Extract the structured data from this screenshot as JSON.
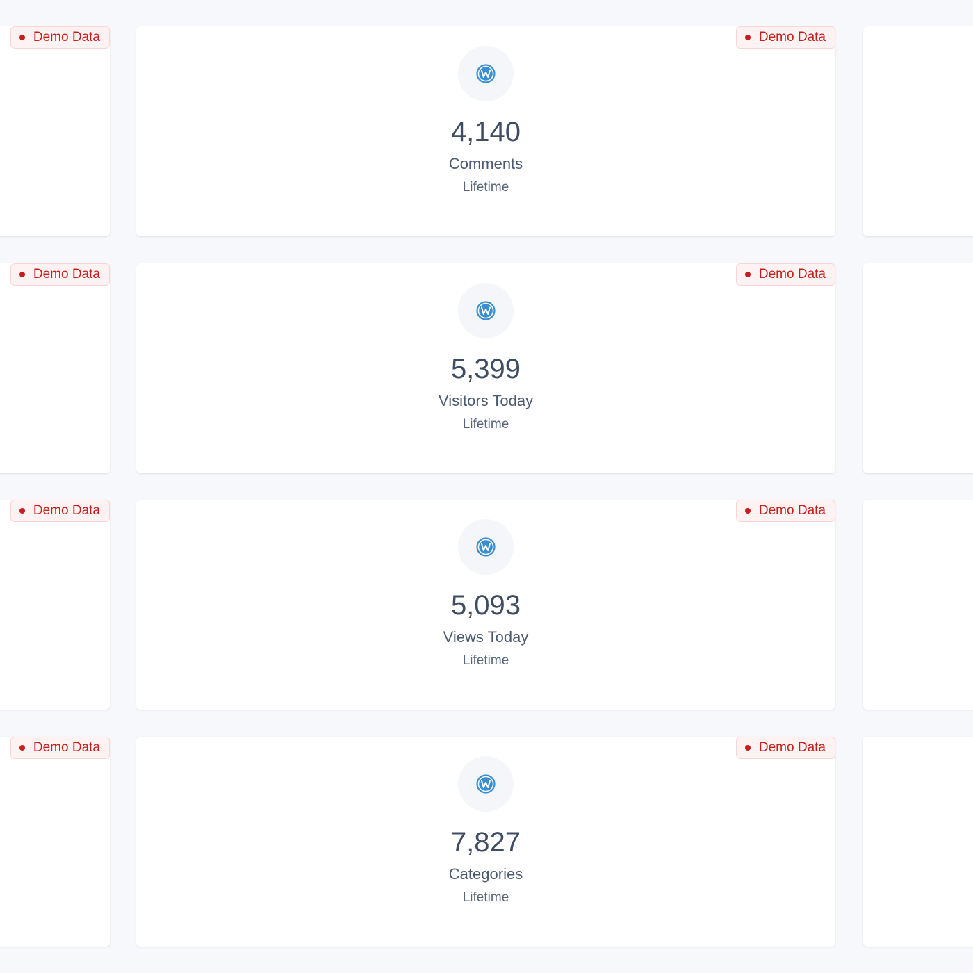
{
  "badge_label": "Demo Data",
  "colors": {
    "background": "#f6f8fb",
    "card": "#ffffff",
    "badge_text": "#c81e1e",
    "badge_bg": "#fef2f2",
    "icon": "#3b8fd0",
    "value_text": "#3f4d63"
  },
  "icon_name": "wordpress-icon",
  "cards": [
    {
      "value": "4,140",
      "label": "Comments",
      "period": "Lifetime"
    },
    {
      "value": "5,399",
      "label": "Visitors Today",
      "period": "Lifetime"
    },
    {
      "value": "5,093",
      "label": "Views Today",
      "period": "Lifetime"
    },
    {
      "value": "7,827",
      "label": "Categories",
      "period": "Lifetime"
    }
  ]
}
